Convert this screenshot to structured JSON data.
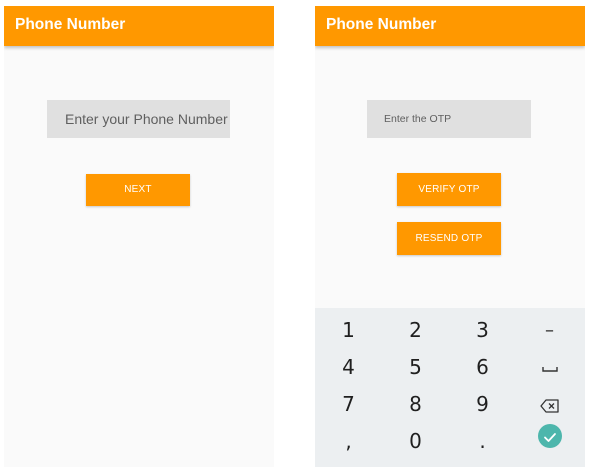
{
  "left_screen": {
    "title": "Phone Number",
    "phone_placeholder": "Enter your Phone Number",
    "next_label": "NEXT"
  },
  "right_screen": {
    "title": "Phone Number",
    "otp_placeholder": "Enter the OTP",
    "verify_label": "VERIFY OTP",
    "resend_label": "RESEND OTP"
  },
  "keyboard": {
    "rows": [
      [
        "1",
        "2",
        "3",
        "–"
      ],
      [
        "4",
        "5",
        "6",
        "space-icon"
      ],
      [
        "7",
        "8",
        "9",
        "backspace-icon"
      ],
      [
        ",",
        "0",
        ".",
        "done-check-icon"
      ]
    ]
  },
  "colors": {
    "accent": "#ff9800",
    "field_bg": "#e0e0e0",
    "keyboard_bg": "#eceff1",
    "done_key": "#4db6ac"
  }
}
